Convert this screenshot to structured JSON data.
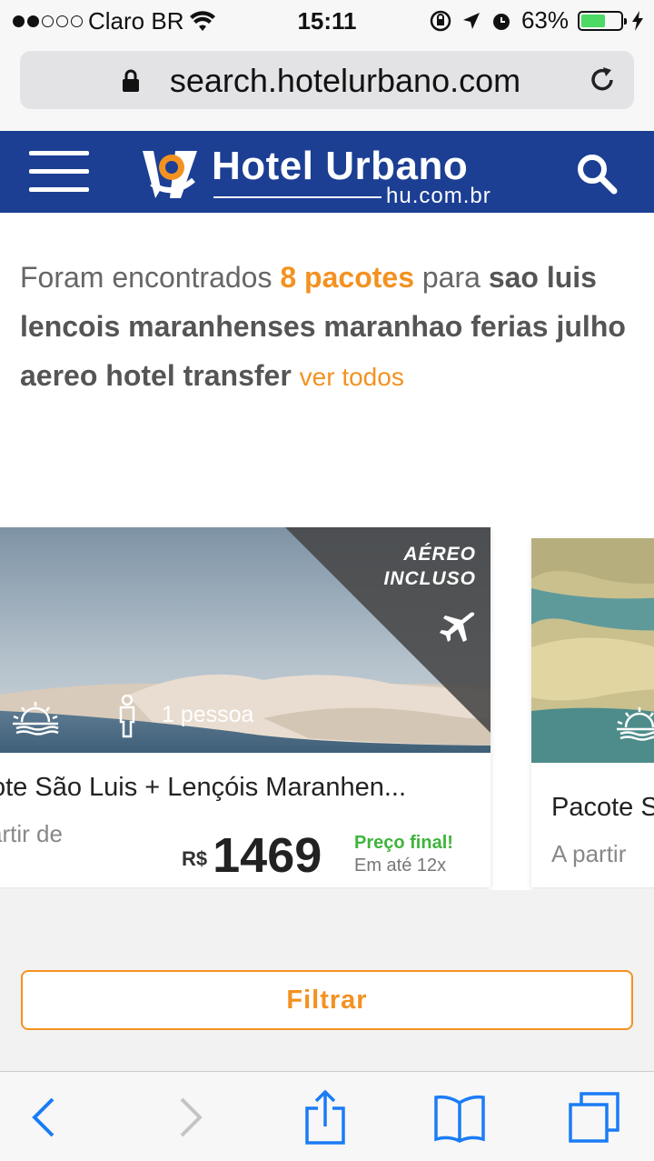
{
  "status_bar": {
    "carrier": "Claro BR",
    "time": "15:11",
    "battery_percent": "63%",
    "battery_level": 0.63,
    "signal_bars_filled": 2,
    "signal_bars_total": 5
  },
  "browser": {
    "url": "search.hotelurbano.com"
  },
  "header": {
    "brand": "Hotel Urbano",
    "domain": "hu.com.br",
    "colors": {
      "background": "#1c3f94",
      "accent": "#f39221"
    }
  },
  "results": {
    "prefix": "Foram encontrados",
    "count": "8 pacotes",
    "middle": "para",
    "query": "sao luis lencois maranhenses maranhao ferias julho aereo hotel transfer",
    "see_all": "ver todos"
  },
  "cards": [
    {
      "badge": [
        "AÉREO",
        "INCLUSO"
      ],
      "people": "1 pessoa",
      "title": "ote São Luis + Lençóis Maranhen...",
      "from_label": "artir de",
      "currency": "R$",
      "price": "1469",
      "final_label": "Preço final!",
      "installments": "Em até 12x"
    },
    {
      "title": "Pacote S",
      "from_label": "A partir"
    }
  ],
  "filter_button": "Filtrar",
  "icons": {
    "lock": "lock-icon",
    "reload": "reload-icon",
    "menu": "menu-icon",
    "search": "search-icon",
    "plane": "plane-icon",
    "sun": "sunset-icon",
    "person": "person-icon",
    "back": "back-arrow-icon",
    "forward": "forward-arrow-icon",
    "share": "share-icon",
    "bookmarks": "bookmarks-icon",
    "tabs": "tabs-icon"
  }
}
